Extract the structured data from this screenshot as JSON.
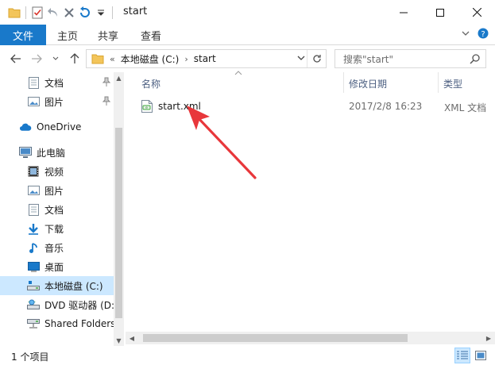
{
  "window": {
    "title": "start"
  },
  "ribbon": {
    "tabs": [
      {
        "label": "文件",
        "active": true
      },
      {
        "label": "主页"
      },
      {
        "label": "共享"
      },
      {
        "label": "查看"
      }
    ]
  },
  "address": {
    "overflow": "«",
    "segments": [
      "本地磁盘 (C:)",
      "start"
    ],
    "separator": "›"
  },
  "search": {
    "placeholder": "搜索\"start\""
  },
  "navpane": {
    "items": [
      {
        "label": "文档",
        "icon": "document-icon",
        "pinned": true
      },
      {
        "label": "图片",
        "icon": "pictures-icon",
        "pinned": true
      },
      {
        "label": "OneDrive",
        "icon": "cloud-icon"
      },
      {
        "label": "此电脑",
        "icon": "computer-icon"
      },
      {
        "label": "视频",
        "icon": "video-icon"
      },
      {
        "label": "图片",
        "icon": "pictures-icon"
      },
      {
        "label": "文档",
        "icon": "document-icon"
      },
      {
        "label": "下载",
        "icon": "download-icon"
      },
      {
        "label": "音乐",
        "icon": "music-icon"
      },
      {
        "label": "桌面",
        "icon": "desktop-icon"
      },
      {
        "label": "本地磁盘 (C:)",
        "icon": "drive-icon",
        "selected": true
      },
      {
        "label": "DVD 驱动器 (D:",
        "icon": "dvd-icon"
      },
      {
        "label": "Shared Folders",
        "icon": "network-drive-icon"
      }
    ]
  },
  "columns": {
    "name": "名称",
    "date": "修改日期",
    "type": "类型"
  },
  "files": [
    {
      "name": "start.xml",
      "modified": "2017/2/8 16:23",
      "type": "XML 文档"
    }
  ],
  "status": {
    "count": "1 个项目"
  },
  "colors": {
    "accent": "#1979ca",
    "selection": "#cce8ff",
    "arrow": "#e8373b"
  }
}
